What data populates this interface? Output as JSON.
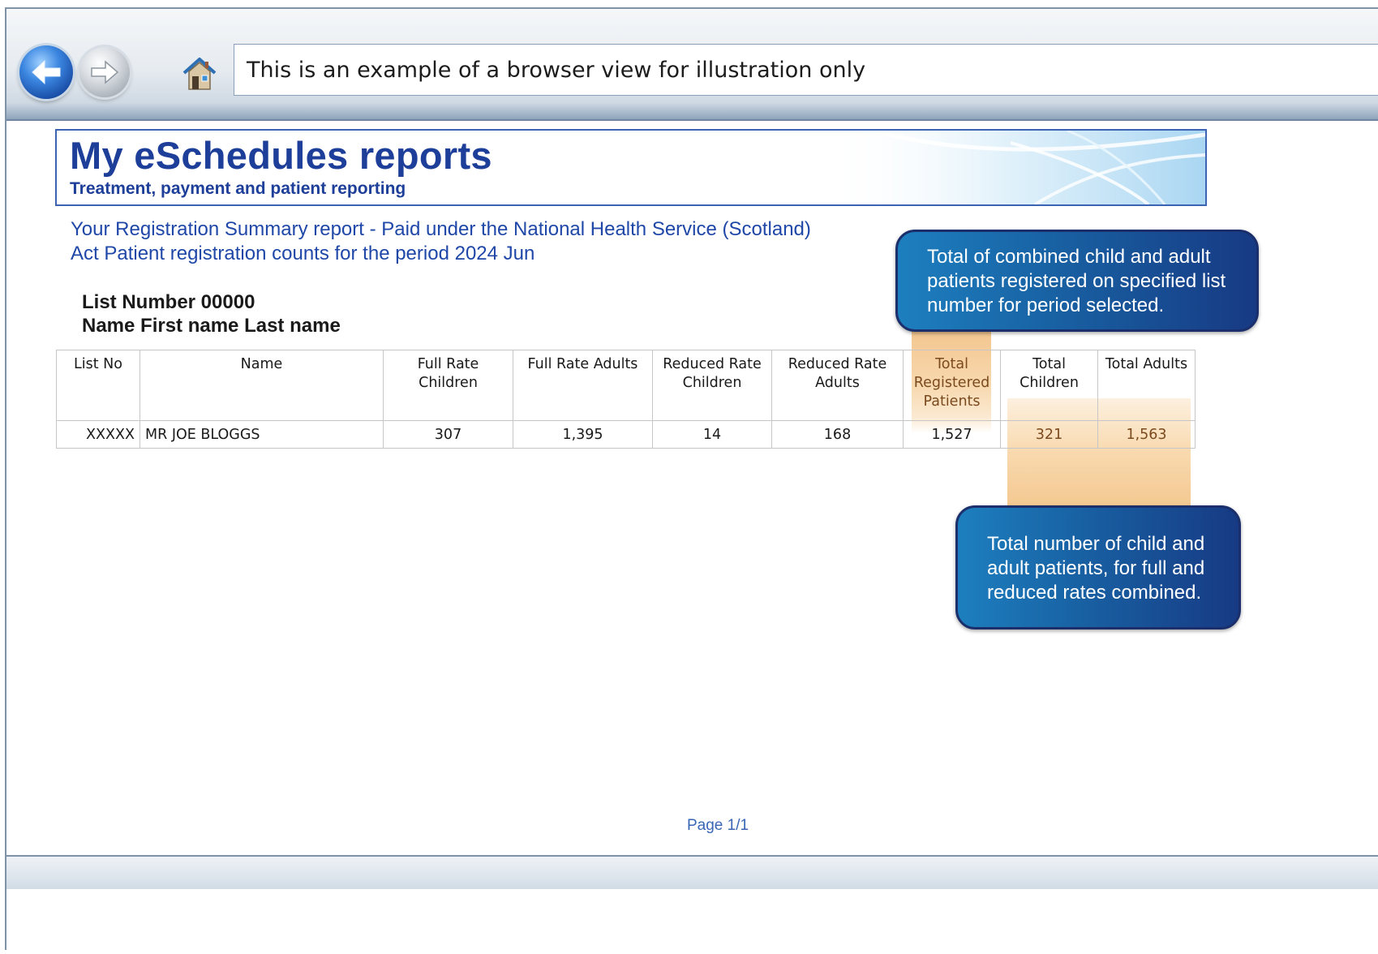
{
  "browser": {
    "address_text": "This is an example of a browser view for illustration only"
  },
  "report": {
    "title": "My eSchedules reports",
    "subtitle": "Treatment, payment and patient reporting",
    "description_line1": "Your Registration Summary report - Paid under the National Health Service (Scotland)",
    "description_line2": "Act Patient registration counts for the period 2024 Jun",
    "list_number": "List Number 00000",
    "list_name": "Name First name Last name"
  },
  "table": {
    "headers": [
      "List No",
      "Name",
      "Full Rate Children",
      "Full Rate Adults",
      "Reduced Rate Children",
      "Reduced Rate Adults",
      "Total Registered Patients",
      "Total Children",
      "Total Adults"
    ],
    "rows": [
      [
        "XXXXX",
        "MR JOE BLOGGS",
        "307",
        "1,395",
        "14",
        "168",
        "1,527",
        "321",
        "1,563"
      ]
    ]
  },
  "callouts": {
    "total_registered": "Total of combined child and adult patients registered on specified list number for period selected.",
    "totals_children_adults": "Total number of child and adult patients, for full and reduced rates combined."
  },
  "footer": {
    "page": "Page 1/1"
  },
  "colors": {
    "title_blue": "#1e3f99",
    "link_blue": "#1f47a8",
    "highlight_orange": "#f3c48c",
    "callout_blue": "#1860a2"
  }
}
